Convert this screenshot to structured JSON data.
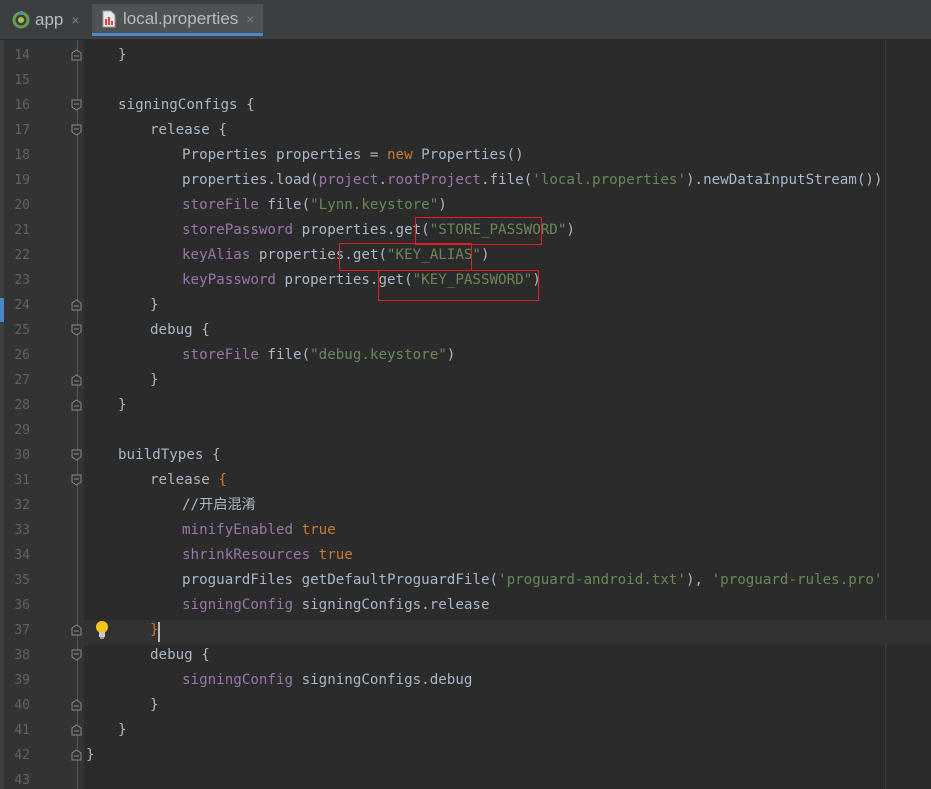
{
  "tabs": [
    {
      "label": "app",
      "icon": "android-module-icon",
      "close": "×"
    },
    {
      "label": "local.properties",
      "icon": "properties-file-icon",
      "close": "×"
    }
  ],
  "colors": {
    "background": "#2b2b2b",
    "gutter": "#313335",
    "line_number": "#606366",
    "plain": "#a9b7c6",
    "keyword": "#cc7832",
    "string": "#6a8759",
    "property": "#9876aa",
    "highlight_box": "#e22222"
  },
  "lines": [
    {
      "n": "14",
      "indent": 1,
      "fold": "end",
      "tokens": [
        {
          "t": "}",
          "c": "plain"
        }
      ]
    },
    {
      "n": "15",
      "indent": 0,
      "fold": "",
      "tokens": []
    },
    {
      "n": "16",
      "indent": 1,
      "fold": "start",
      "tokens": [
        {
          "t": "signingConfigs {",
          "c": "plain"
        }
      ]
    },
    {
      "n": "17",
      "indent": 2,
      "fold": "start",
      "tokens": [
        {
          "t": "release {",
          "c": "plain"
        }
      ]
    },
    {
      "n": "18",
      "indent": 3,
      "fold": "",
      "tokens": [
        {
          "t": "Properties properties = ",
          "c": "plain"
        },
        {
          "t": "new",
          "c": "keyword"
        },
        {
          "t": " Properties()",
          "c": "plain"
        }
      ]
    },
    {
      "n": "19",
      "indent": 3,
      "fold": "",
      "tokens": [
        {
          "t": "properties.load(",
          "c": "plain"
        },
        {
          "t": "project",
          "c": "property"
        },
        {
          "t": ".",
          "c": "plain"
        },
        {
          "t": "rootProject",
          "c": "property"
        },
        {
          "t": ".file(",
          "c": "plain"
        },
        {
          "t": "'local.properties'",
          "c": "string"
        },
        {
          "t": ").newDataInputStream())",
          "c": "plain"
        }
      ]
    },
    {
      "n": "20",
      "indent": 3,
      "fold": "",
      "tokens": [
        {
          "t": "storeFile",
          "c": "property"
        },
        {
          "t": " file(",
          "c": "plain"
        },
        {
          "t": "\"Lynn.keystore\"",
          "c": "string"
        },
        {
          "t": ")",
          "c": "plain"
        }
      ]
    },
    {
      "n": "21",
      "indent": 3,
      "fold": "",
      "tokens": [
        {
          "t": "storePassword",
          "c": "property"
        },
        {
          "t": " properties.get(",
          "c": "plain"
        },
        {
          "t": "\"STORE_PASSWORD\"",
          "c": "string"
        },
        {
          "t": ")",
          "c": "plain"
        }
      ]
    },
    {
      "n": "22",
      "indent": 3,
      "fold": "",
      "tokens": [
        {
          "t": "keyAlias",
          "c": "property"
        },
        {
          "t": " properties.get(",
          "c": "plain"
        },
        {
          "t": "\"KEY_ALIAS\"",
          "c": "string"
        },
        {
          "t": ")",
          "c": "plain"
        }
      ]
    },
    {
      "n": "23",
      "indent": 3,
      "fold": "",
      "tokens": [
        {
          "t": "keyPassword",
          "c": "property"
        },
        {
          "t": " properties.get(",
          "c": "plain"
        },
        {
          "t": "\"KEY_PASSWORD\"",
          "c": "string"
        },
        {
          "t": ")",
          "c": "plain"
        }
      ]
    },
    {
      "n": "24",
      "indent": 2,
      "fold": "end",
      "tokens": [
        {
          "t": "}",
          "c": "plain"
        }
      ]
    },
    {
      "n": "25",
      "indent": 2,
      "fold": "start",
      "tokens": [
        {
          "t": "debug {",
          "c": "plain"
        }
      ]
    },
    {
      "n": "26",
      "indent": 3,
      "fold": "",
      "tokens": [
        {
          "t": "storeFile",
          "c": "property"
        },
        {
          "t": " file(",
          "c": "plain"
        },
        {
          "t": "\"debug.keystore\"",
          "c": "string"
        },
        {
          "t": ")",
          "c": "plain"
        }
      ]
    },
    {
      "n": "27",
      "indent": 2,
      "fold": "end",
      "tokens": [
        {
          "t": "}",
          "c": "plain"
        }
      ]
    },
    {
      "n": "28",
      "indent": 1,
      "fold": "end",
      "tokens": [
        {
          "t": "}",
          "c": "plain"
        }
      ]
    },
    {
      "n": "29",
      "indent": 0,
      "fold": "",
      "tokens": []
    },
    {
      "n": "30",
      "indent": 1,
      "fold": "start",
      "tokens": [
        {
          "t": "buildTypes {",
          "c": "plain"
        }
      ]
    },
    {
      "n": "31",
      "indent": 2,
      "fold": "start",
      "tokens": [
        {
          "t": "release ",
          "c": "plain"
        },
        {
          "t": "{",
          "c": "keyword"
        }
      ]
    },
    {
      "n": "32",
      "indent": 3,
      "fold": "",
      "tokens": [
        {
          "t": "//开启混淆",
          "c": "plain"
        }
      ]
    },
    {
      "n": "33",
      "indent": 3,
      "fold": "",
      "tokens": [
        {
          "t": "minifyEnabled",
          "c": "property"
        },
        {
          "t": " ",
          "c": "plain"
        },
        {
          "t": "true",
          "c": "keyword"
        }
      ]
    },
    {
      "n": "34",
      "indent": 3,
      "fold": "",
      "tokens": [
        {
          "t": "shrinkResources",
          "c": "property"
        },
        {
          "t": " ",
          "c": "plain"
        },
        {
          "t": "true",
          "c": "keyword"
        }
      ]
    },
    {
      "n": "35",
      "indent": 3,
      "fold": "",
      "tokens": [
        {
          "t": "proguardFiles getDefaultProguardFile(",
          "c": "plain"
        },
        {
          "t": "'proguard-android.txt'",
          "c": "string"
        },
        {
          "t": "), ",
          "c": "plain"
        },
        {
          "t": "'proguard-rules.pro'",
          "c": "string"
        }
      ]
    },
    {
      "n": "36",
      "indent": 3,
      "fold": "",
      "tokens": [
        {
          "t": "signingConfig",
          "c": "property"
        },
        {
          "t": " signingConfigs.release",
          "c": "plain"
        }
      ]
    },
    {
      "n": "37",
      "indent": 2,
      "fold": "end",
      "tokens": [
        {
          "t": "}",
          "c": "keyword"
        }
      ]
    },
    {
      "n": "38",
      "indent": 2,
      "fold": "start",
      "tokens": [
        {
          "t": "debug {",
          "c": "plain"
        }
      ]
    },
    {
      "n": "39",
      "indent": 3,
      "fold": "",
      "tokens": [
        {
          "t": "signingConfig",
          "c": "property"
        },
        {
          "t": " signingConfigs.debug",
          "c": "plain"
        }
      ]
    },
    {
      "n": "40",
      "indent": 2,
      "fold": "end",
      "tokens": [
        {
          "t": "}",
          "c": "plain"
        }
      ]
    },
    {
      "n": "41",
      "indent": 1,
      "fold": "end",
      "tokens": [
        {
          "t": "}",
          "c": "plain"
        }
      ]
    },
    {
      "n": "42",
      "indent": 0,
      "fold": "end",
      "tokens": [
        {
          "t": "}",
          "c": "plain"
        }
      ]
    },
    {
      "n": "43",
      "indent": 0,
      "fold": "",
      "tokens": []
    }
  ],
  "intention_icon": "lightbulb-icon"
}
